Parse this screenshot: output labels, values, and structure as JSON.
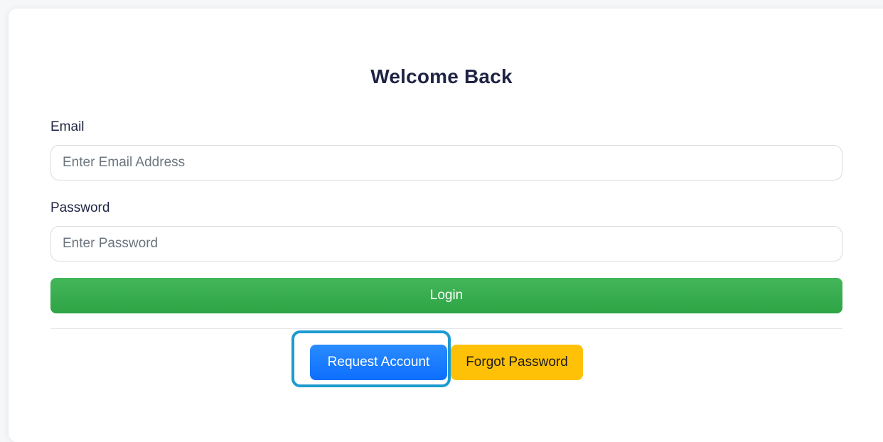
{
  "form": {
    "title": "Welcome Back",
    "email": {
      "label": "Email",
      "placeholder": "Enter Email Address",
      "value": ""
    },
    "password": {
      "label": "Password",
      "placeholder": "Enter Password",
      "value": ""
    },
    "login_label": "Login"
  },
  "actions": {
    "request_account_label": "Request Account",
    "forgot_password_label": "Forgot Password"
  },
  "colors": {
    "login": "#2ea445",
    "request_account": "#0d6efd",
    "forgot_password": "#ffc107",
    "focus_ring": "#1d9bd1"
  }
}
